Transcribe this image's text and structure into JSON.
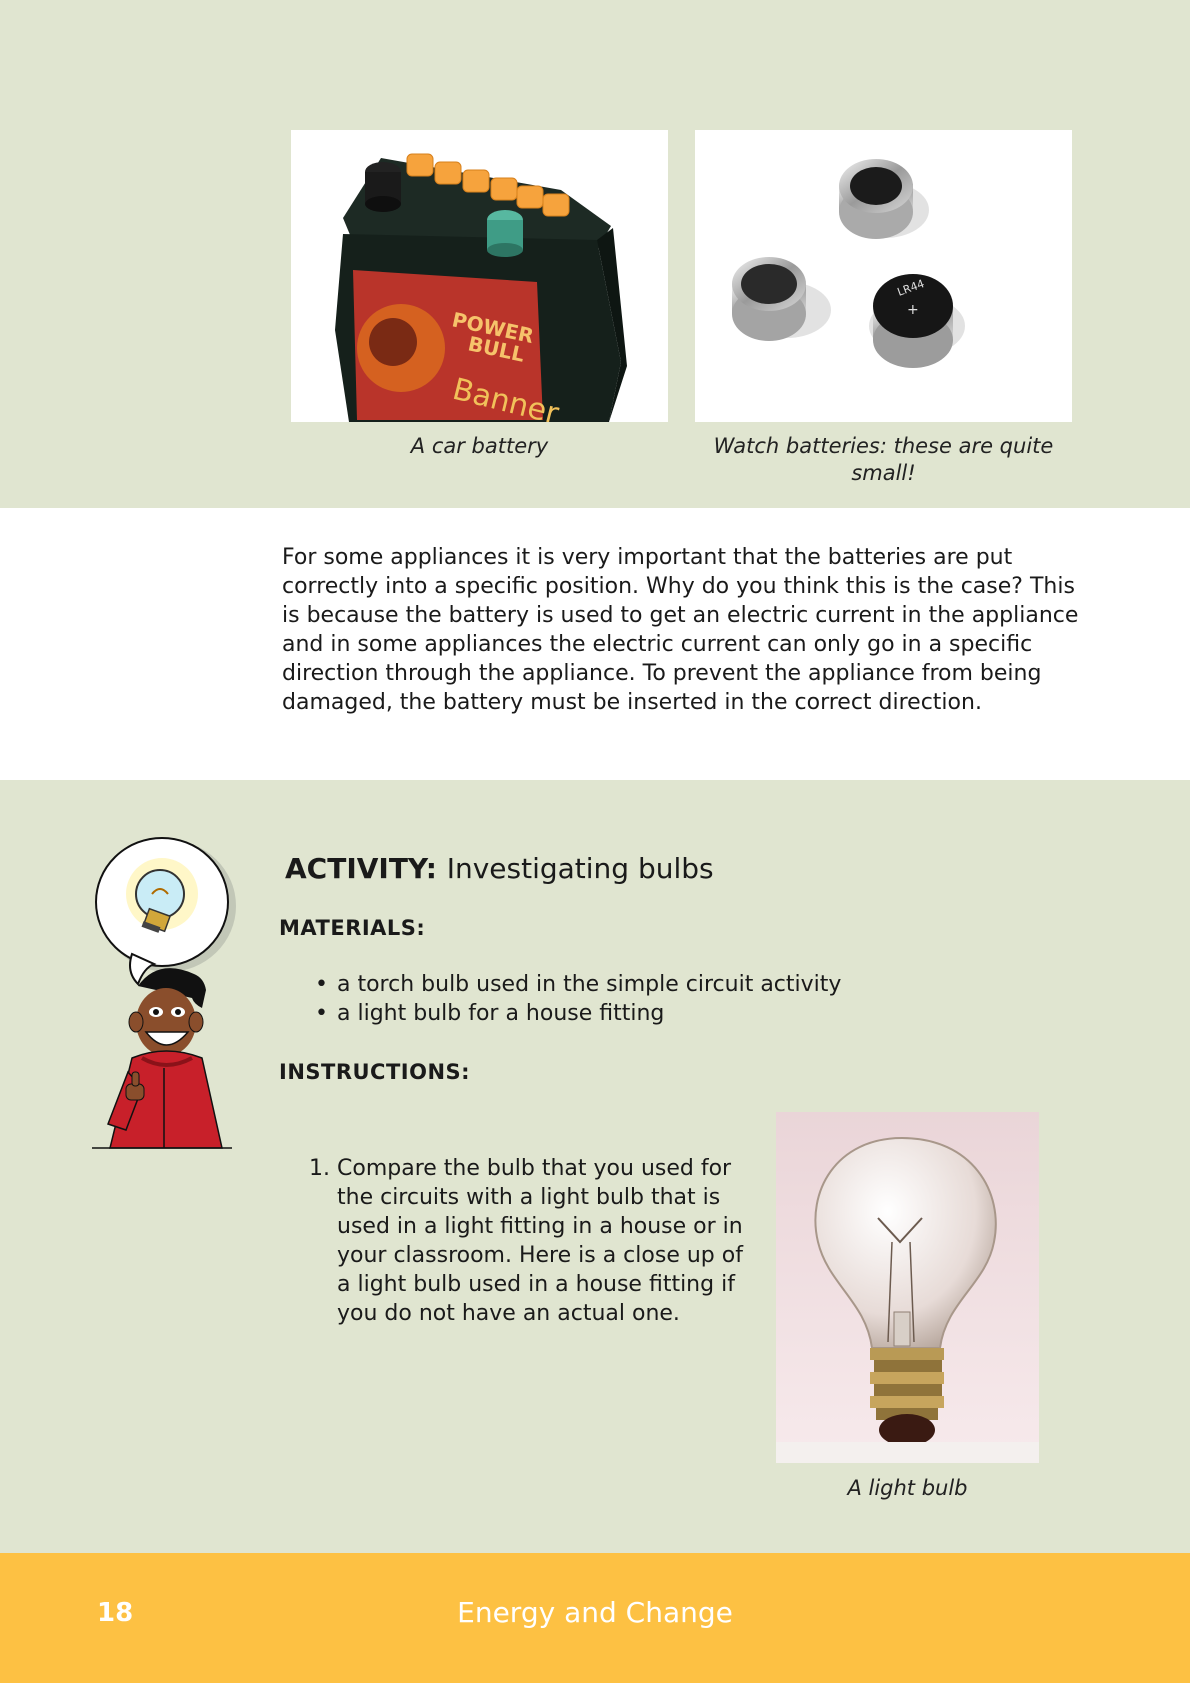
{
  "photos": {
    "car_battery": {
      "caption": "A car battery",
      "label_line1": "POWER",
      "label_line2": "BULL",
      "brand": "Banner"
    },
    "watch_batteries": {
      "caption": "Watch batteries: these are quite small!",
      "cell_text": "LR44"
    },
    "light_bulb": {
      "caption": "A light bulb"
    }
  },
  "intro_paragraph": "For some appliances it is very important that the batteries are put correctly into a specific position. Why do you think this is the case? This is because the battery is used to get an electric current in the appliance and in some appliances the electric current can only go in a specific direction through the appliance. To prevent the appliance from being damaged, the battery must be inserted in the correct direction.",
  "activity": {
    "label": "ACTIVITY:",
    "title": "Investigating bulbs",
    "materials_heading": "MATERIALS:",
    "materials": [
      "a torch bulb used in the simple circuit activity",
      "a light bulb for a house fitting"
    ],
    "instructions_heading": "INSTRUCTIONS:",
    "steps": [
      {
        "number": "1.",
        "text": "Compare the bulb that you used for the circuits with a light bulb that is used in a light fitting in a house or in your classroom. Here is a close up of a light bulb used in a house fitting if you do not have an actual one."
      }
    ]
  },
  "footer": {
    "page_number": "18",
    "book_title": "Energy and Change"
  },
  "colors": {
    "band_green": "#e0e5d0",
    "footer_yellow": "#fdc143"
  },
  "icons": {
    "mascot": "cartoon-boy-thumbs-up-icon",
    "idea": "lightbulb-thought-bubble-icon"
  }
}
